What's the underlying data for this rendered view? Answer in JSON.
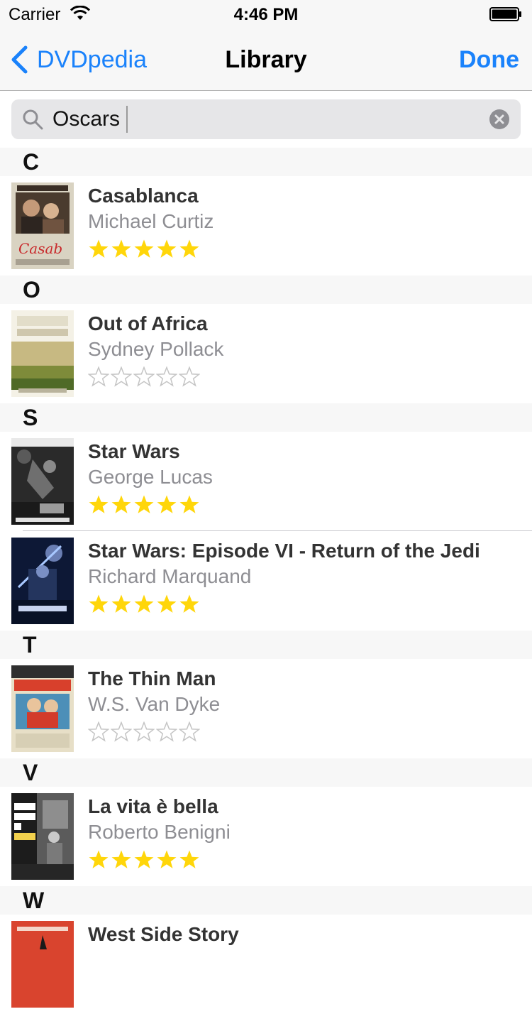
{
  "status_bar": {
    "carrier": "Carrier",
    "time": "4:46 PM"
  },
  "nav": {
    "back_label": "DVDpedia",
    "title": "Library",
    "done_label": "Done"
  },
  "search": {
    "value": "Oscars"
  },
  "colors": {
    "accent": "#1a82fb",
    "star_filled": "#ffd60a",
    "star_empty": "#c4c4c4"
  },
  "sections": [
    {
      "letter": "C",
      "items": [
        {
          "title": "Casablanca",
          "director": "Michael Curtiz",
          "rating": 5,
          "poster": "casablanca-poster"
        }
      ]
    },
    {
      "letter": "O",
      "items": [
        {
          "title": "Out of Africa",
          "director": "Sydney Pollack",
          "rating": 0,
          "poster": "out-of-africa-poster"
        }
      ]
    },
    {
      "letter": "S",
      "items": [
        {
          "title": "Star Wars",
          "director": "George Lucas",
          "rating": 5,
          "poster": "star-wars-poster"
        },
        {
          "title": "Star Wars: Episode VI - Return of the Jedi",
          "director": "Richard Marquand",
          "rating": 5,
          "poster": "return-of-the-jedi-poster"
        }
      ]
    },
    {
      "letter": "T",
      "items": [
        {
          "title": "The Thin Man",
          "director": "W.S. Van Dyke",
          "rating": 0,
          "poster": "the-thin-man-poster"
        }
      ]
    },
    {
      "letter": "V",
      "items": [
        {
          "title": "La vita è bella",
          "director": "Roberto Benigni",
          "rating": 5,
          "poster": "la-vita-e-bella-poster"
        }
      ]
    },
    {
      "letter": "W",
      "items": [
        {
          "title": "West Side Story",
          "director": "",
          "rating": 0,
          "poster": "west-side-story-poster"
        }
      ]
    }
  ]
}
